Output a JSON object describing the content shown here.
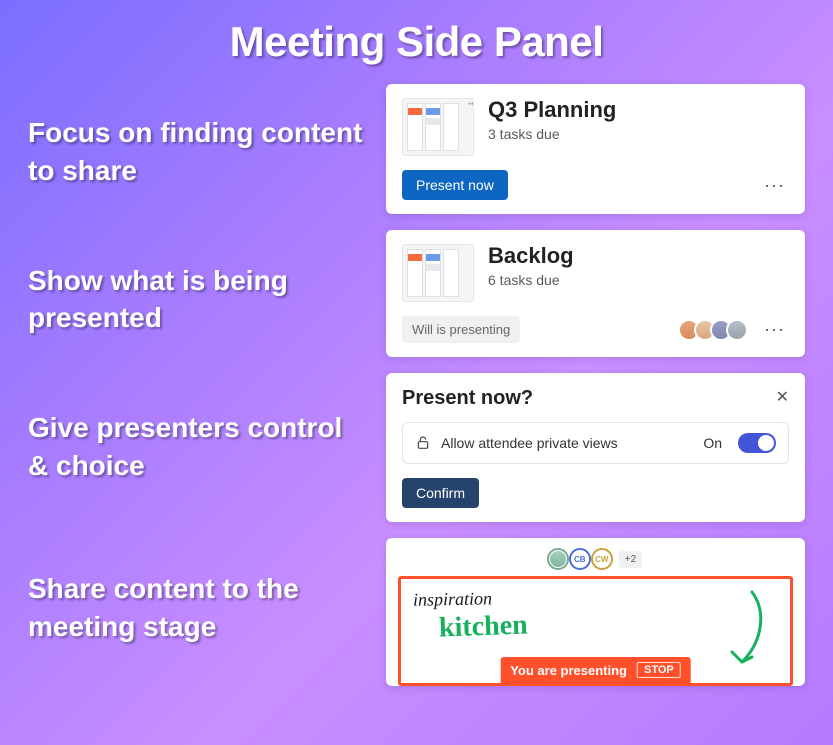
{
  "header": {
    "title": "Meeting Side Panel"
  },
  "features": [
    "Focus on finding content to share",
    "Show what is being presented",
    "Give presenters control & choice",
    "Share content to the meeting stage"
  ],
  "cards": {
    "planning": {
      "title": "Q3 Planning",
      "subtitle": "3 tasks due",
      "cta": "Present now"
    },
    "backlog": {
      "title": "Backlog",
      "subtitle": "6 tasks due",
      "status": "Will is presenting"
    }
  },
  "confirm": {
    "question": "Present now?",
    "toggle_label": "Allow attendee private views",
    "toggle_state": "On",
    "confirm_label": "Confirm"
  },
  "stage": {
    "avatars": {
      "cb": "CB",
      "cw": "CW",
      "more": "+2"
    },
    "hand1": "inspiration",
    "hand2": "kitchen",
    "bar_text": "You are presenting",
    "stop": "STOP"
  }
}
